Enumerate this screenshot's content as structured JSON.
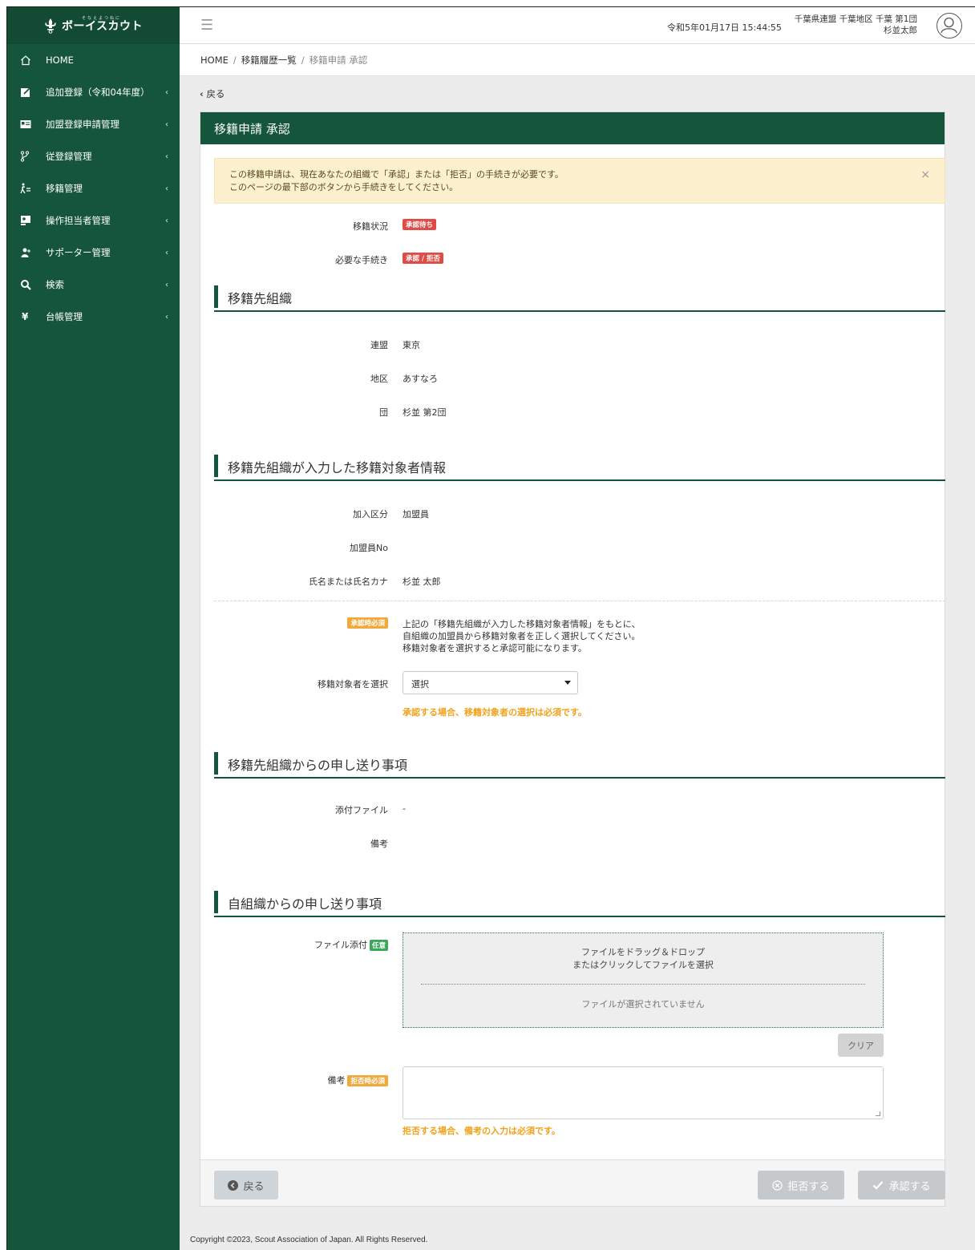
{
  "brand": {
    "kana": "そなえよつねに",
    "name": "ボーイスカウト"
  },
  "sidebar": {
    "items": [
      {
        "label": "HOME",
        "icon": "home-icon",
        "has_chevron": false
      },
      {
        "label": "追加登録（令和04年度）",
        "icon": "edit-icon",
        "has_chevron": true
      },
      {
        "label": "加盟登録申請管理",
        "icon": "id-card-icon",
        "has_chevron": true
      },
      {
        "label": "従登録管理",
        "icon": "branch-icon",
        "has_chevron": true
      },
      {
        "label": "移籍管理",
        "icon": "transfer-icon",
        "has_chevron": true
      },
      {
        "label": "操作担当者管理",
        "icon": "operator-icon",
        "has_chevron": true
      },
      {
        "label": "サポーター管理",
        "icon": "supporter-icon",
        "has_chevron": true
      },
      {
        "label": "検索",
        "icon": "search-icon",
        "has_chevron": true
      },
      {
        "label": "台帳管理",
        "icon": "yen-icon",
        "has_chevron": true
      }
    ],
    "chevron": "‹"
  },
  "topbar": {
    "datetime": "令和5年01月17日 15:44:55",
    "org": "千葉県連盟 千葉地区 千葉 第1団",
    "user": "杉並太郎"
  },
  "breadcrumb": {
    "home": "HOME",
    "list": "移籍履歴一覧",
    "current": "移籍申請 承認",
    "sep": "/"
  },
  "back_link": "戻る",
  "card": {
    "title": "移籍申請 承認",
    "alert_line1": "この移籍申請は、現在あなたの組織で「承認」または「拒否」の手続きが必要です。",
    "alert_line2": "このページの最下部のボタンから手続きをしてください。",
    "alert_close": "×",
    "status": {
      "label": "移籍状況",
      "badge": "承認待ち"
    },
    "procedure": {
      "label": "必要な手続き",
      "badge": "承認 / 拒否"
    }
  },
  "section_dest": {
    "title": "移籍先組織",
    "federation": {
      "label": "連盟",
      "value": "東京"
    },
    "district": {
      "label": "地区",
      "value": "あすなろ"
    },
    "group": {
      "label": "団",
      "value": "杉並 第2団"
    }
  },
  "section_target": {
    "title": "移籍先組織が入力した移籍対象者情報",
    "join_type": {
      "label": "加入区分",
      "value": "加盟員"
    },
    "member_no": {
      "label": "加盟員No",
      "value": ""
    },
    "name": {
      "label": "氏名または氏名カナ",
      "value": "杉並 太郎"
    },
    "required_badge": "承認時必須",
    "help_line1": "上記の「移籍先組織が入力した移籍対象者情報」をもとに、",
    "help_line2": "自組織の加盟員から移籍対象者を正しく選択してください。",
    "help_line3": "移籍対象者を選択すると承認可能になります。",
    "select_label": "移籍対象者を選択",
    "select_value": "選択",
    "warning": "承認する場合、移籍対象者の選択は必須です。"
  },
  "section_notes_from_dest": {
    "title": "移籍先組織からの申し送り事項",
    "attachment": {
      "label": "添付ファイル",
      "value": "-"
    },
    "remarks": {
      "label": "備考",
      "value": ""
    }
  },
  "section_own_notes": {
    "title": "自組織からの申し送り事項",
    "file_label": "ファイル添付",
    "optional_badge": "任意",
    "drop_line1": "ファイルをドラッグ＆ドロップ",
    "drop_line2": "またはクリックしてファイルを選択",
    "no_file": "ファイルが選択されていません",
    "clear": "クリア",
    "remark_label": "備考",
    "remark_badge": "拒否時必須",
    "remark_value": "",
    "remark_warning": "拒否する場合、備考の入力は必須です。"
  },
  "footer_buttons": {
    "back": "戻る",
    "reject": "拒否する",
    "approve": "承認する"
  },
  "copyright": "Copyright ©2023, Scout Association of Japan. All Rights Reserved.",
  "colors": {
    "primary": "#15553c",
    "alert_bg": "#fdf0cf",
    "badge_red": "#e04b45",
    "badge_orange": "#f2a93b",
    "badge_green": "#3aa75a",
    "warning_text": "#f2a21b"
  }
}
